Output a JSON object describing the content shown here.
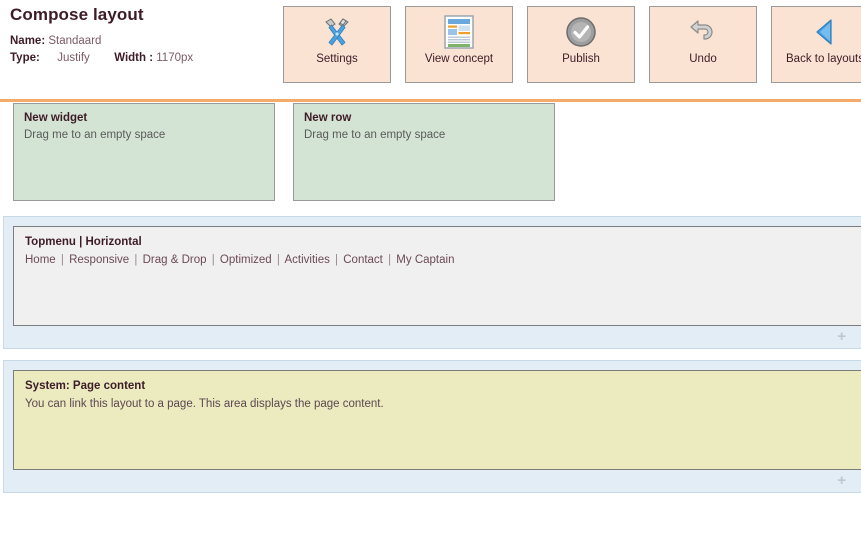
{
  "header": {
    "title": "Compose layout",
    "name_label": "Name:",
    "name_value": "Standaard",
    "type_label": "Type:",
    "type_value": "Justify",
    "width_label": "Width :",
    "width_value": "1170px"
  },
  "toolbar": {
    "buttons": [
      {
        "label": "Settings",
        "icon": "tools-icon"
      },
      {
        "label": "View concept",
        "icon": "document-preview-icon"
      },
      {
        "label": "Publish",
        "icon": "check-circle-icon"
      },
      {
        "label": "Undo",
        "icon": "undo-arrow-icon"
      },
      {
        "label": "Back to layouts",
        "icon": "back-triangle-icon"
      }
    ]
  },
  "drag_sources": [
    {
      "title": "New widget",
      "subtitle": "Drag me to an empty space"
    },
    {
      "title": "New row",
      "subtitle": "Drag me to an empty space"
    }
  ],
  "containers": [
    {
      "panel_title": "Topmenu | Horizontal",
      "menu_items": [
        "Home",
        "Responsive",
        "Drag & Drop",
        "Optimized",
        "Activities",
        "Contact",
        "My Captain"
      ],
      "separator": "|",
      "add_label": "+"
    },
    {
      "panel_title": "System: Page content",
      "panel_text": "You can link this layout to a page. This area displays the page content.",
      "add_label": "+"
    }
  ],
  "colors": {
    "button_fill": "#fae3d2",
    "divider": "#f4ab6a",
    "drag_box": "#d4e4d4",
    "container_band": "#e2edf5",
    "menu_panel": "#f0f0f0",
    "system_panel": "#ebebbf"
  }
}
